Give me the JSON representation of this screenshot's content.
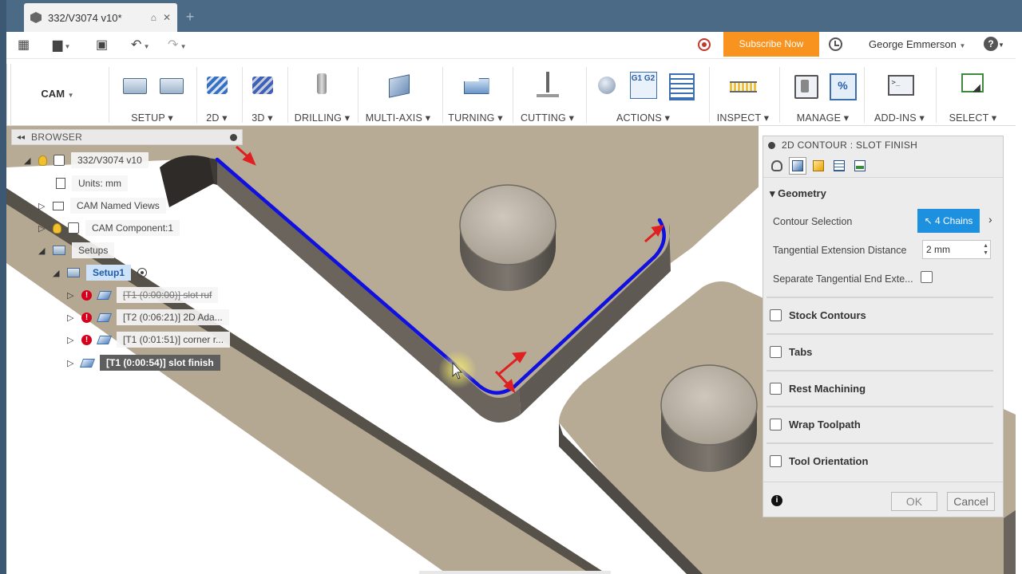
{
  "window": {
    "tab_title": "332/V3074 v10*",
    "tab_icon": "cube-icon"
  },
  "quickbar": {
    "subscribe_label": "Subscribe Now",
    "user_name": "George Emmerson",
    "help_label": "?"
  },
  "ribbon": {
    "workspace_label": "CAM",
    "groups": [
      "SETUP",
      "2D",
      "3D",
      "DRILLING",
      "MULTI-AXIS",
      "TURNING",
      "CUTTING",
      "ACTIONS",
      "INSPECT",
      "MANAGE",
      "ADD-INS",
      "SELECT"
    ],
    "g12": "G1 G2"
  },
  "browser": {
    "title": "BROWSER",
    "root": "332/V3074 v10",
    "units": "Units: mm",
    "named_views": "CAM Named Views",
    "component": "CAM Component:1",
    "setups": "Setups",
    "setup1": "Setup1",
    "ops": [
      "[T1 (0:00:00)] slot ruf",
      "[T2 (0:06:21)] 2D Ada...",
      "[T1 (0:01:51)] corner r...",
      "[T1 (0:00:54)] slot finish"
    ]
  },
  "dialog": {
    "title": "2D CONTOUR : SLOT FINISH",
    "geometry_header": "Geometry",
    "contour_selection_label": "Contour Selection",
    "chains_button": "4 Chains",
    "tangential_label": "Tangential Extension Distance",
    "tangential_value": "2 mm",
    "separate_label": "Separate Tangential End Exte...",
    "sections": [
      "Stock Contours",
      "Tabs",
      "Rest Machining",
      "Wrap Toolpath",
      "Tool Orientation"
    ],
    "ok_label": "OK",
    "cancel_label": "Cancel"
  },
  "colors": {
    "title_bar": "#4a6a86",
    "subscribe": "#f7931e",
    "toolpath": "#1010e0",
    "part_top": "#b8ab95",
    "chains_button": "#1e90e0"
  }
}
